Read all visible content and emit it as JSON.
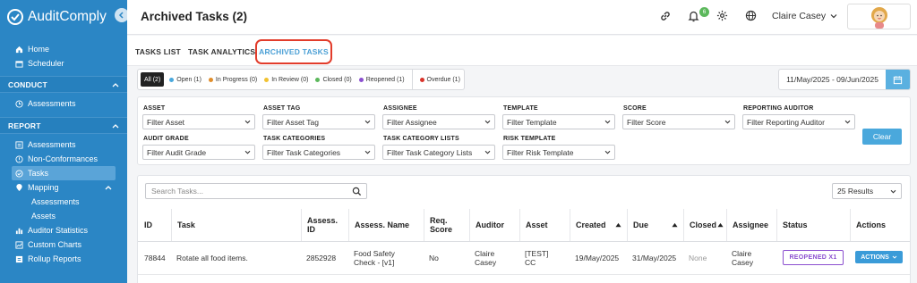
{
  "app": {
    "name": "AuditComply"
  },
  "sidebar": {
    "items_top": [
      {
        "label": "Home"
      },
      {
        "label": "Scheduler"
      }
    ],
    "conduct": {
      "header": "CONDUCT",
      "items": [
        {
          "label": "Assessments"
        }
      ]
    },
    "report": {
      "header": "REPORT",
      "items": [
        {
          "label": "Assessments"
        },
        {
          "label": "Non-Conformances"
        },
        {
          "label": "Tasks"
        },
        {
          "label": "Mapping"
        },
        {
          "label": "Assessments"
        },
        {
          "label": "Assets"
        },
        {
          "label": "Auditor Statistics"
        },
        {
          "label": "Custom Charts"
        },
        {
          "label": "Rollup Reports"
        }
      ]
    }
  },
  "header": {
    "title": "Archived Tasks (2)",
    "notifications_count": "6",
    "user_name": "Claire Casey"
  },
  "tabs": [
    {
      "label": "TASKS LIST"
    },
    {
      "label": "TASK ANALYTICS"
    },
    {
      "label": "ARCHIVED TASKS"
    }
  ],
  "status_filters": [
    {
      "label": "All (2)",
      "color": ""
    },
    {
      "label": "Open (1)",
      "color": "#4aa8dc"
    },
    {
      "label": "In Progress (0)",
      "color": "#e08e2c"
    },
    {
      "label": "In Review (0)",
      "color": "#f1c232"
    },
    {
      "label": "Closed (0)",
      "color": "#5cb85c"
    },
    {
      "label": "Reopened (1)",
      "color": "#8b4fcf"
    },
    {
      "label": "Overdue (1)",
      "color": "#d9342b"
    }
  ],
  "date_range": "11/May/2025 - 09/Jun/2025",
  "filters": [
    {
      "label": "ASSET",
      "placeholder": "Filter Asset"
    },
    {
      "label": "ASSET TAG",
      "placeholder": "Filter Asset Tag"
    },
    {
      "label": "ASSIGNEE",
      "placeholder": "Filter Assignee"
    },
    {
      "label": "TEMPLATE",
      "placeholder": "Filter Template"
    },
    {
      "label": "SCORE",
      "placeholder": "Filter Score"
    },
    {
      "label": "REPORTING AUDITOR",
      "placeholder": "Filter Reporting Auditor"
    },
    {
      "label": "AUDIT GRADE",
      "placeholder": "Filter Audit Grade"
    },
    {
      "label": "TASK CATEGORIES",
      "placeholder": "Filter Task Categories"
    },
    {
      "label": "TASK CATEGORY LISTS",
      "placeholder": "Filter Task Category Lists"
    },
    {
      "label": "RISK TEMPLATE",
      "placeholder": "Filter Risk Template"
    }
  ],
  "clear_label": "Clear",
  "search_placeholder": "Search Tasks...",
  "results_label": "25 Results",
  "table": {
    "columns": [
      "ID",
      "Task",
      "Assess. ID",
      "Assess. Name",
      "Req. Score",
      "Auditor",
      "Asset",
      "Created",
      "Due",
      "Closed",
      "Assignee",
      "Status",
      "Actions"
    ],
    "rows": [
      {
        "id": "78844",
        "task": "Rotate all food items.",
        "assess_id": "2852928",
        "assess_name": "Food Safety Check - [v1]",
        "req_score": "No",
        "auditor": "Claire Casey",
        "asset": "[TEST] CC",
        "created": "19/May/2025",
        "due": "31/May/2025",
        "closed": "None",
        "assignee": "Claire Casey",
        "status": "REOPENED X1",
        "actions": "ACTIONS"
      }
    ]
  }
}
